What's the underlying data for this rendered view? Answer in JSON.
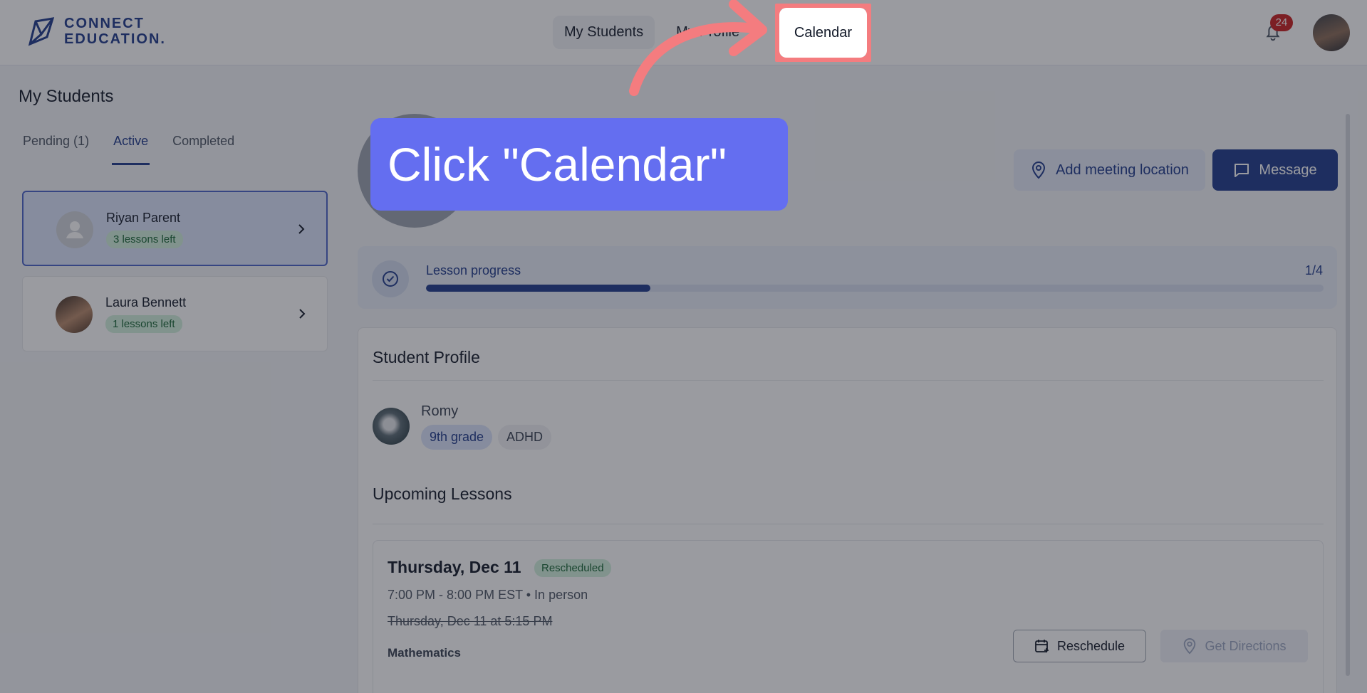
{
  "brand": {
    "line1": "CONNECT",
    "line2": "EDUCATION."
  },
  "nav": {
    "items": [
      "My Students",
      "My Profile",
      "Calendar"
    ]
  },
  "notifications": {
    "count": "24"
  },
  "sidebar": {
    "title": "My Students",
    "tabs": [
      "Pending (1)",
      "Active",
      "Completed"
    ],
    "students": [
      {
        "name": "Riyan Parent",
        "lessons": "3 lessons left"
      },
      {
        "name": "Laura Bennett",
        "lessons": "1 lessons left"
      }
    ]
  },
  "actions": {
    "add_location": "Add meeting location",
    "message": "Message"
  },
  "progress": {
    "label": "Lesson progress",
    "count": "1/4",
    "fraction": 0.25
  },
  "profile": {
    "title": "Student Profile",
    "student_name": "Romy",
    "tags": [
      "9th grade",
      "ADHD"
    ]
  },
  "upcoming": {
    "title": "Upcoming Lessons",
    "lesson": {
      "date": "Thursday, Dec 11",
      "status": "Rescheduled",
      "time": "7:00 PM - 8:00 PM EST • In person",
      "old_time": "Thursday, Dec 11 at 5:15 PM",
      "subject": "Mathematics",
      "reschedule_label": "Reschedule",
      "directions_label": "Get Directions"
    }
  },
  "tutorial": {
    "callout": "Click \"Calendar\""
  },
  "colors": {
    "accent": "#1e3a8a",
    "callout": "#646ef0",
    "highlight": "#f47c7f"
  }
}
